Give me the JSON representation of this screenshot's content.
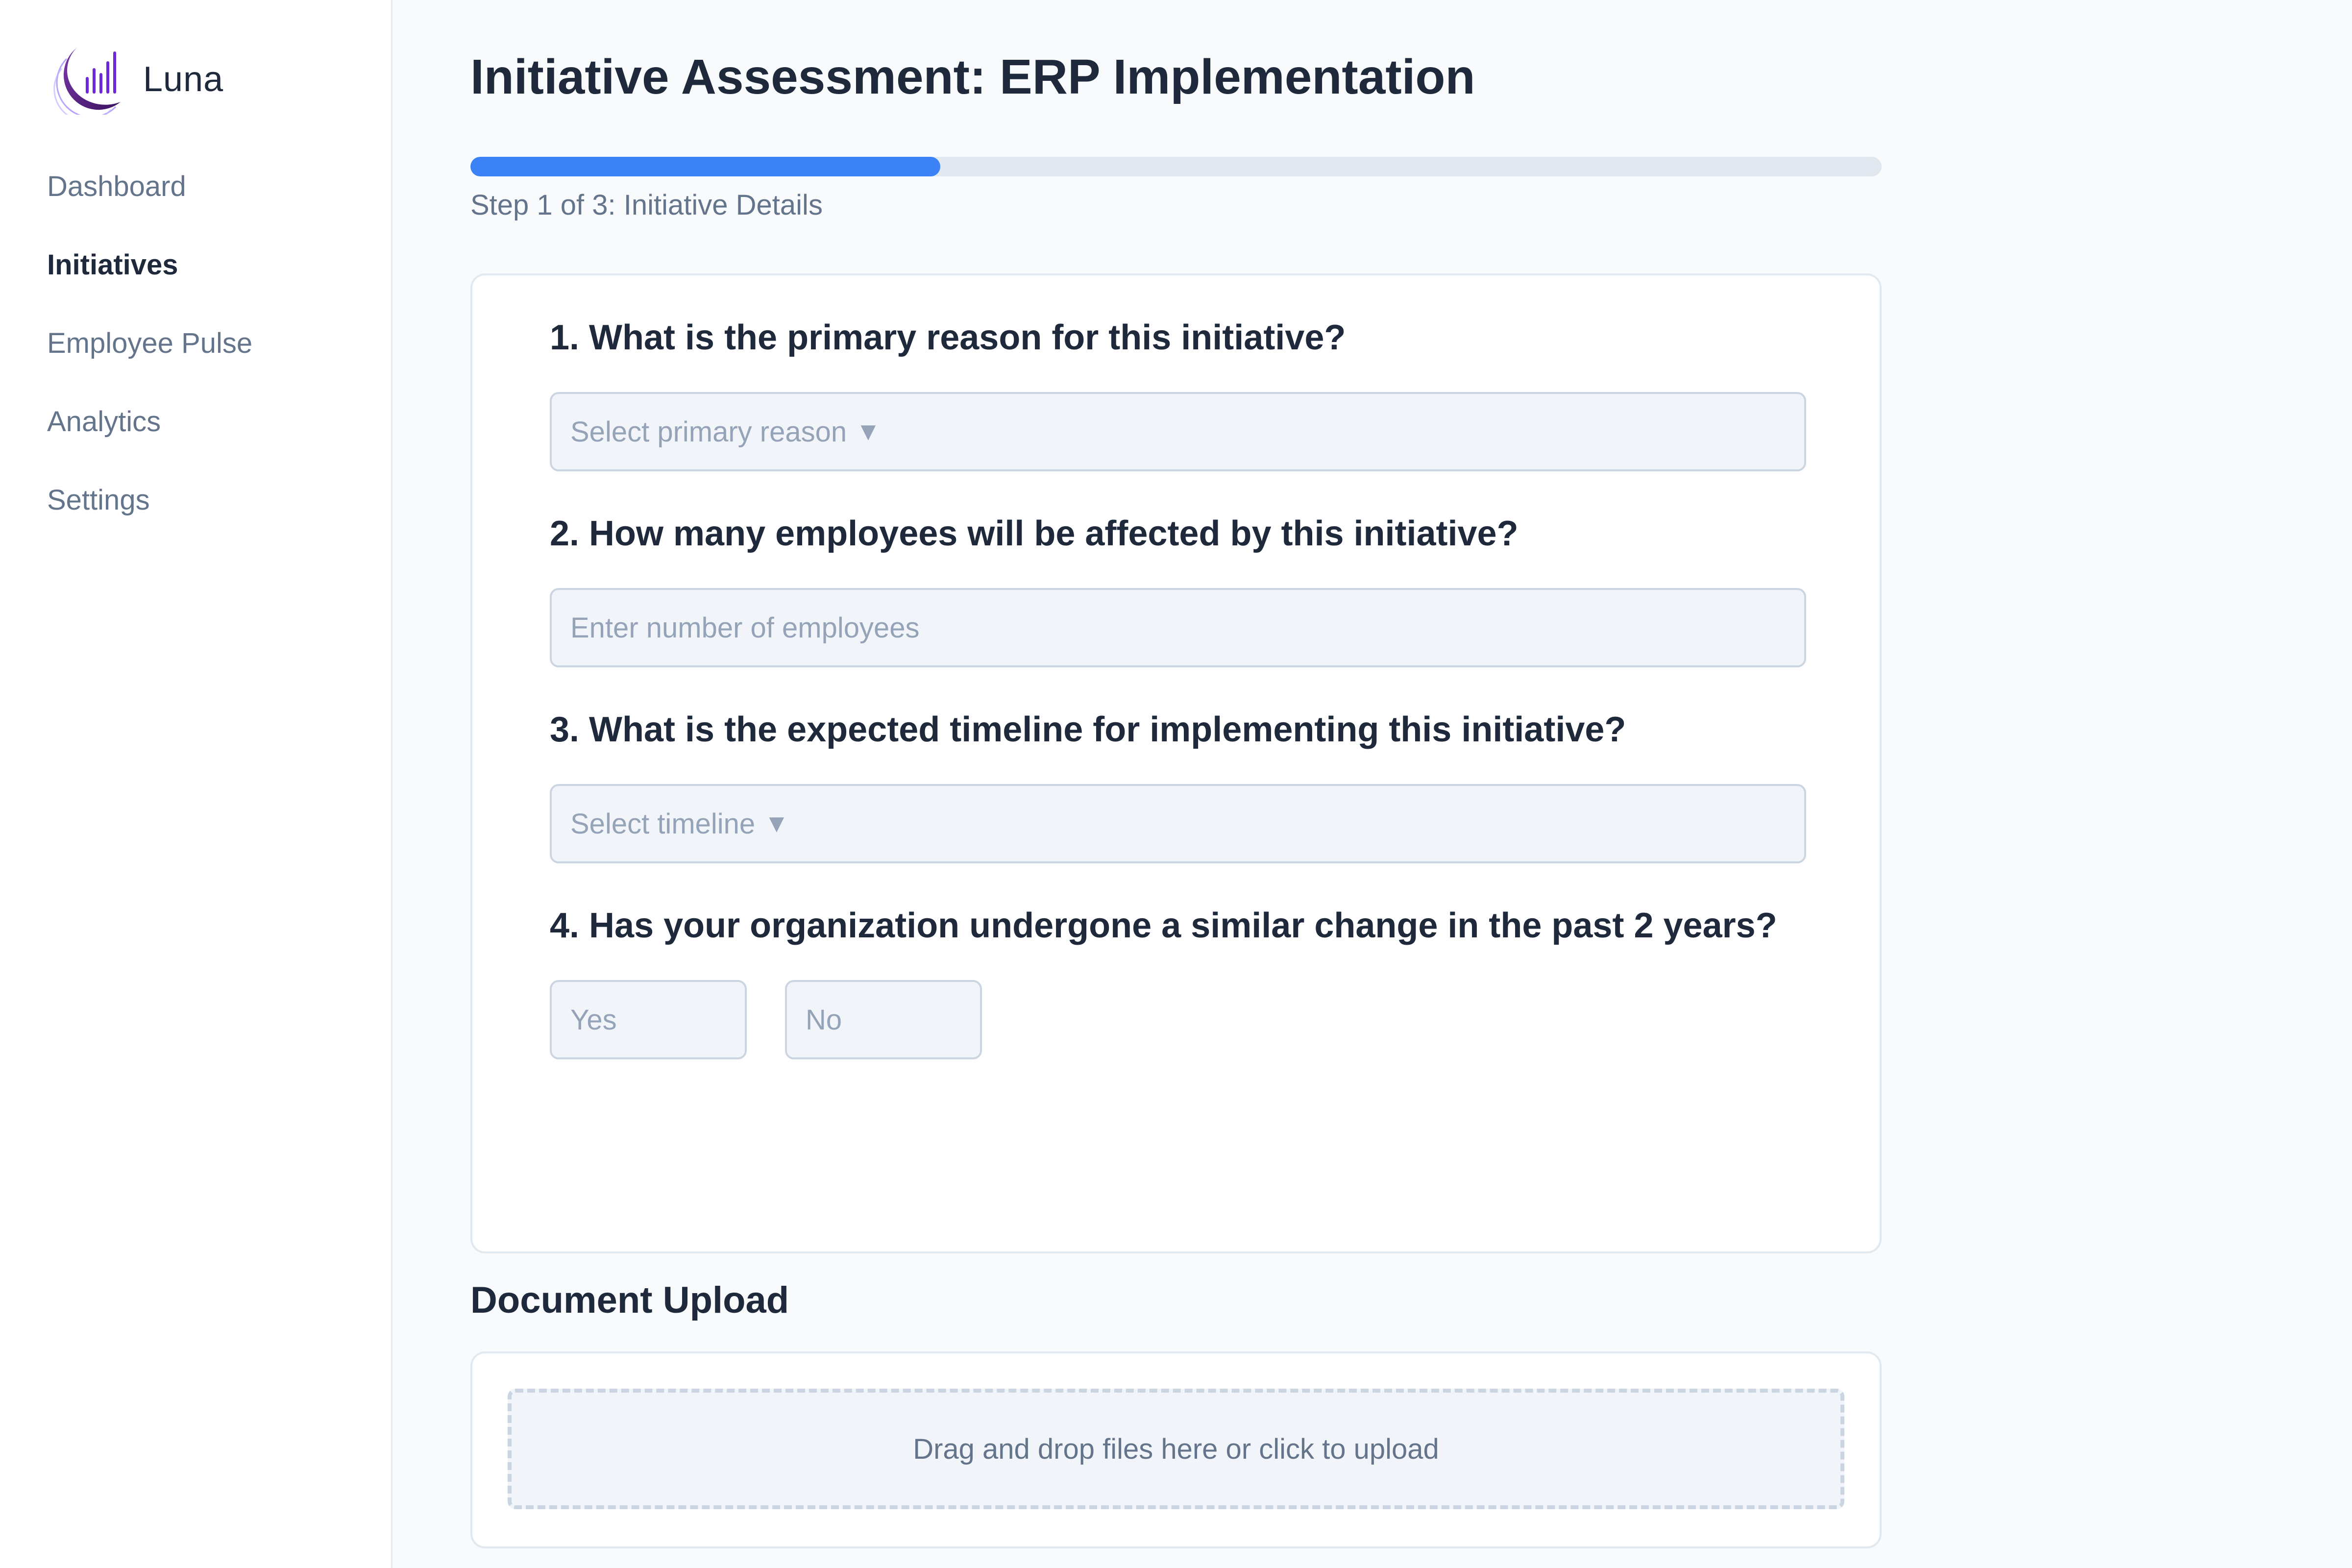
{
  "app": {
    "name": "Luna",
    "logo_icon": "luna-logo-icon"
  },
  "sidebar": {
    "items": [
      {
        "label": "Dashboard",
        "active": false
      },
      {
        "label": "Initiatives",
        "active": true
      },
      {
        "label": "Employee Pulse",
        "active": false
      },
      {
        "label": "Analytics",
        "active": false
      },
      {
        "label": "Settings",
        "active": false
      }
    ]
  },
  "page": {
    "title": "Initiative Assessment: ERP Implementation",
    "progress": {
      "fraction": 0.333,
      "step_label": "Step 1 of 3: Initiative Details"
    }
  },
  "questions": [
    {
      "label": "1. What is the primary reason for this initiative?",
      "type": "select",
      "placeholder": "Select primary reason",
      "caret": "▼"
    },
    {
      "label": "2. How many employees will be affected by this initiative?",
      "type": "input",
      "placeholder": "Enter number of employees"
    },
    {
      "label": "3. What is the expected timeline for implementing this initiative?",
      "type": "select",
      "placeholder": "Select timeline",
      "caret": "▼"
    },
    {
      "label": "4. Has your organization undergone a similar change in the past 2 years?",
      "type": "choice",
      "options": [
        "Yes",
        "No"
      ]
    }
  ],
  "upload": {
    "title": "Document Upload",
    "dropzone_text": "Drag and drop files here or click to upload"
  },
  "colors": {
    "accent": "#3b82f6",
    "text_primary": "#1e293b",
    "text_muted": "#64748b",
    "placeholder": "#94a3b8",
    "logo_purple": "#5b2a86"
  }
}
